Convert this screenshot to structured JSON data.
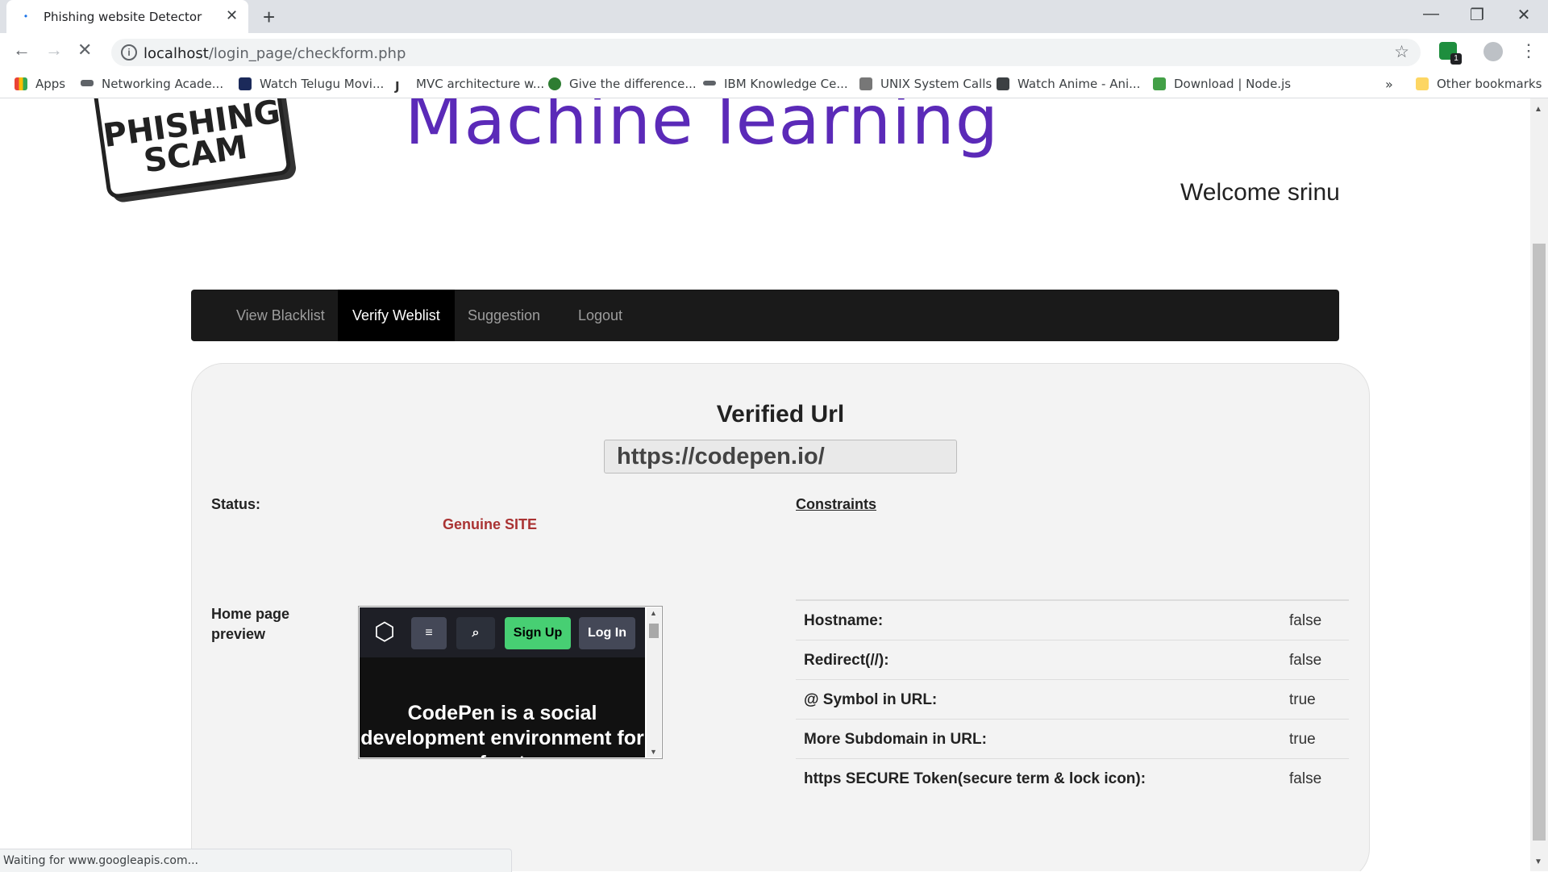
{
  "browser": {
    "tab_title": "Phishing website Detector",
    "url_host": "localhost",
    "url_path": "/login_page/checkform.php",
    "bookmarks": [
      {
        "label": "Apps",
        "icon": "apps-grid-icon"
      },
      {
        "label": "Networking Acade...",
        "icon": "cisco-icon"
      },
      {
        "label": "Watch Telugu Movi...",
        "icon": "movie-icon"
      },
      {
        "label": "MVC architecture w...",
        "icon": "j-icon"
      },
      {
        "label": "Give the difference...",
        "icon": "globe-icon"
      },
      {
        "label": "IBM Knowledge Ce...",
        "icon": "ibm-icon"
      },
      {
        "label": "UNIX System Calls",
        "icon": "unix-icon"
      },
      {
        "label": "Watch Anime - Ani...",
        "icon": "anime-icon"
      },
      {
        "label": "Download | Node.js",
        "icon": "nodejs-icon"
      }
    ],
    "other_bookmarks": "Other bookmarks",
    "overflow": "»",
    "extension_badge": "1",
    "status_text": "Waiting for www.googleapis.com..."
  },
  "page": {
    "logo_text": "PHISHING\nSCAM",
    "headline": "Machine learning",
    "welcome": "Welcome srinu",
    "nav": [
      {
        "label": "View Blacklist",
        "active": false
      },
      {
        "label": "Verify Weblist",
        "active": true
      },
      {
        "label": "Suggestion",
        "active": false
      },
      {
        "label": "Logout",
        "active": false
      }
    ],
    "verified_title": "Verified Url",
    "verified_url": "https://codepen.io/",
    "status_label": "Status:",
    "status_value": "Genuine SITE",
    "constraints_label": "Constraints",
    "preview_label": "Home page preview",
    "preview": {
      "signup": "Sign Up",
      "login": "Log In",
      "text": "CodePen is a social development environment for front"
    },
    "constraints": [
      {
        "name": "Hostname:",
        "value": "false"
      },
      {
        "name": "Redirect(//):",
        "value": "false"
      },
      {
        "name": "@ Symbol in URL:",
        "value": "true"
      },
      {
        "name": "More Subdomain in URL:",
        "value": "true"
      },
      {
        "name": "https SECURE Token(secure term & lock icon):",
        "value": "false"
      }
    ]
  },
  "colors": {
    "headline": "#5b2ab8",
    "navbar": "#1a1a1a",
    "status_genuine": "#aa3333",
    "signup_green": "#47cf73"
  }
}
